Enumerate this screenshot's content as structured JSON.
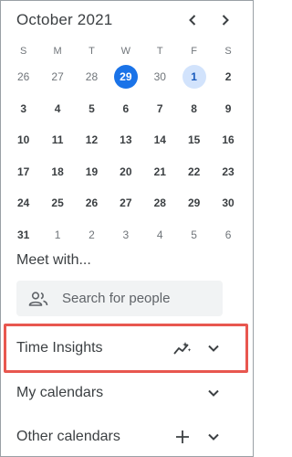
{
  "calendar": {
    "title": "October 2021",
    "weekdays": [
      "S",
      "M",
      "T",
      "W",
      "T",
      "F",
      "S"
    ],
    "weeks": [
      [
        "26",
        "27",
        "28",
        "29",
        "30",
        "1",
        "2"
      ],
      [
        "3",
        "4",
        "5",
        "6",
        "7",
        "8",
        "9"
      ],
      [
        "10",
        "11",
        "12",
        "13",
        "14",
        "15",
        "16"
      ],
      [
        "17",
        "18",
        "19",
        "20",
        "21",
        "22",
        "23"
      ],
      [
        "24",
        "25",
        "26",
        "27",
        "28",
        "29",
        "30"
      ],
      [
        "31",
        "1",
        "2",
        "3",
        "4",
        "5",
        "6"
      ]
    ],
    "today": "29",
    "selected": "1"
  },
  "meet": {
    "title": "Meet with...",
    "search_placeholder": "Search for people"
  },
  "sections": {
    "time_insights": "Time Insights",
    "my_calendars": "My calendars",
    "other_calendars": "Other calendars"
  },
  "colors": {
    "today": "#1a73e8",
    "selected": "#d2e3fc",
    "highlight_border": "#e8574f"
  }
}
